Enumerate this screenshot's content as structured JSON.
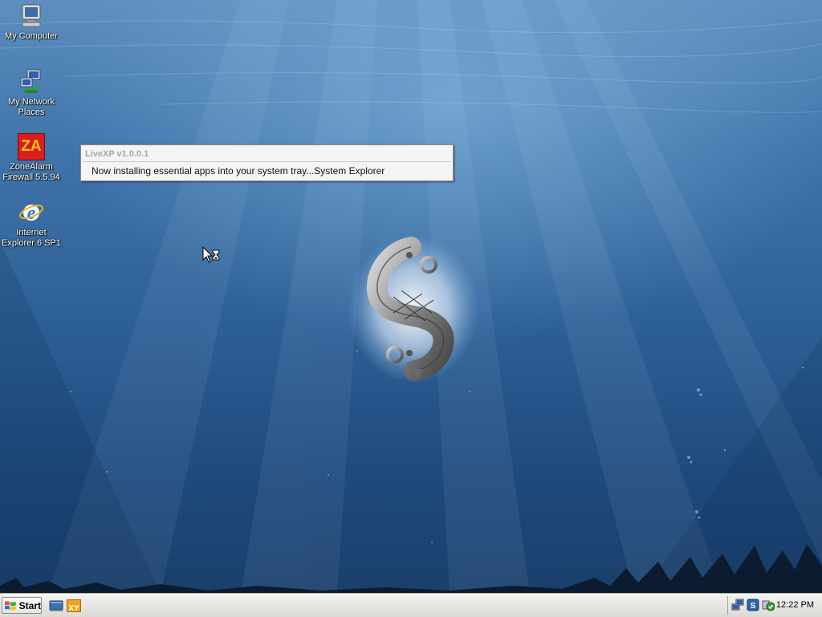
{
  "desktop": {
    "icons": [
      {
        "label": "My Computer",
        "icon": "my-computer-icon"
      },
      {
        "label": "My Network\nPlaces",
        "icon": "network-places-icon"
      },
      {
        "label": "ZoneAlarm\nFirewall 5.5.94",
        "icon": "zonealarm-icon",
        "badge": "ZA"
      },
      {
        "label": "Internet\nExplorer 6 SP1",
        "icon": "internet-explorer-icon"
      }
    ]
  },
  "splash": {
    "title": "LiveXP v1.0.0.1",
    "message": "Now installing essential apps into your system tray...System Explorer"
  },
  "taskbar": {
    "start_label": "Start",
    "quick_launch": [
      "show-desktop-icon",
      "xy-app-icon"
    ],
    "xy_label": "XY",
    "tray_icons": [
      "network-connection-icon",
      "system-explorer-icon",
      "zonealarm-tray-icon"
    ],
    "clock": "12:22 PM"
  },
  "colors": {
    "wallpaper_top": "#5d8fbf",
    "wallpaper_bottom": "#1a3f6c",
    "taskbar": "#ebeae5",
    "za_red": "#d81e1e",
    "za_yellow": "#f2c31a"
  }
}
